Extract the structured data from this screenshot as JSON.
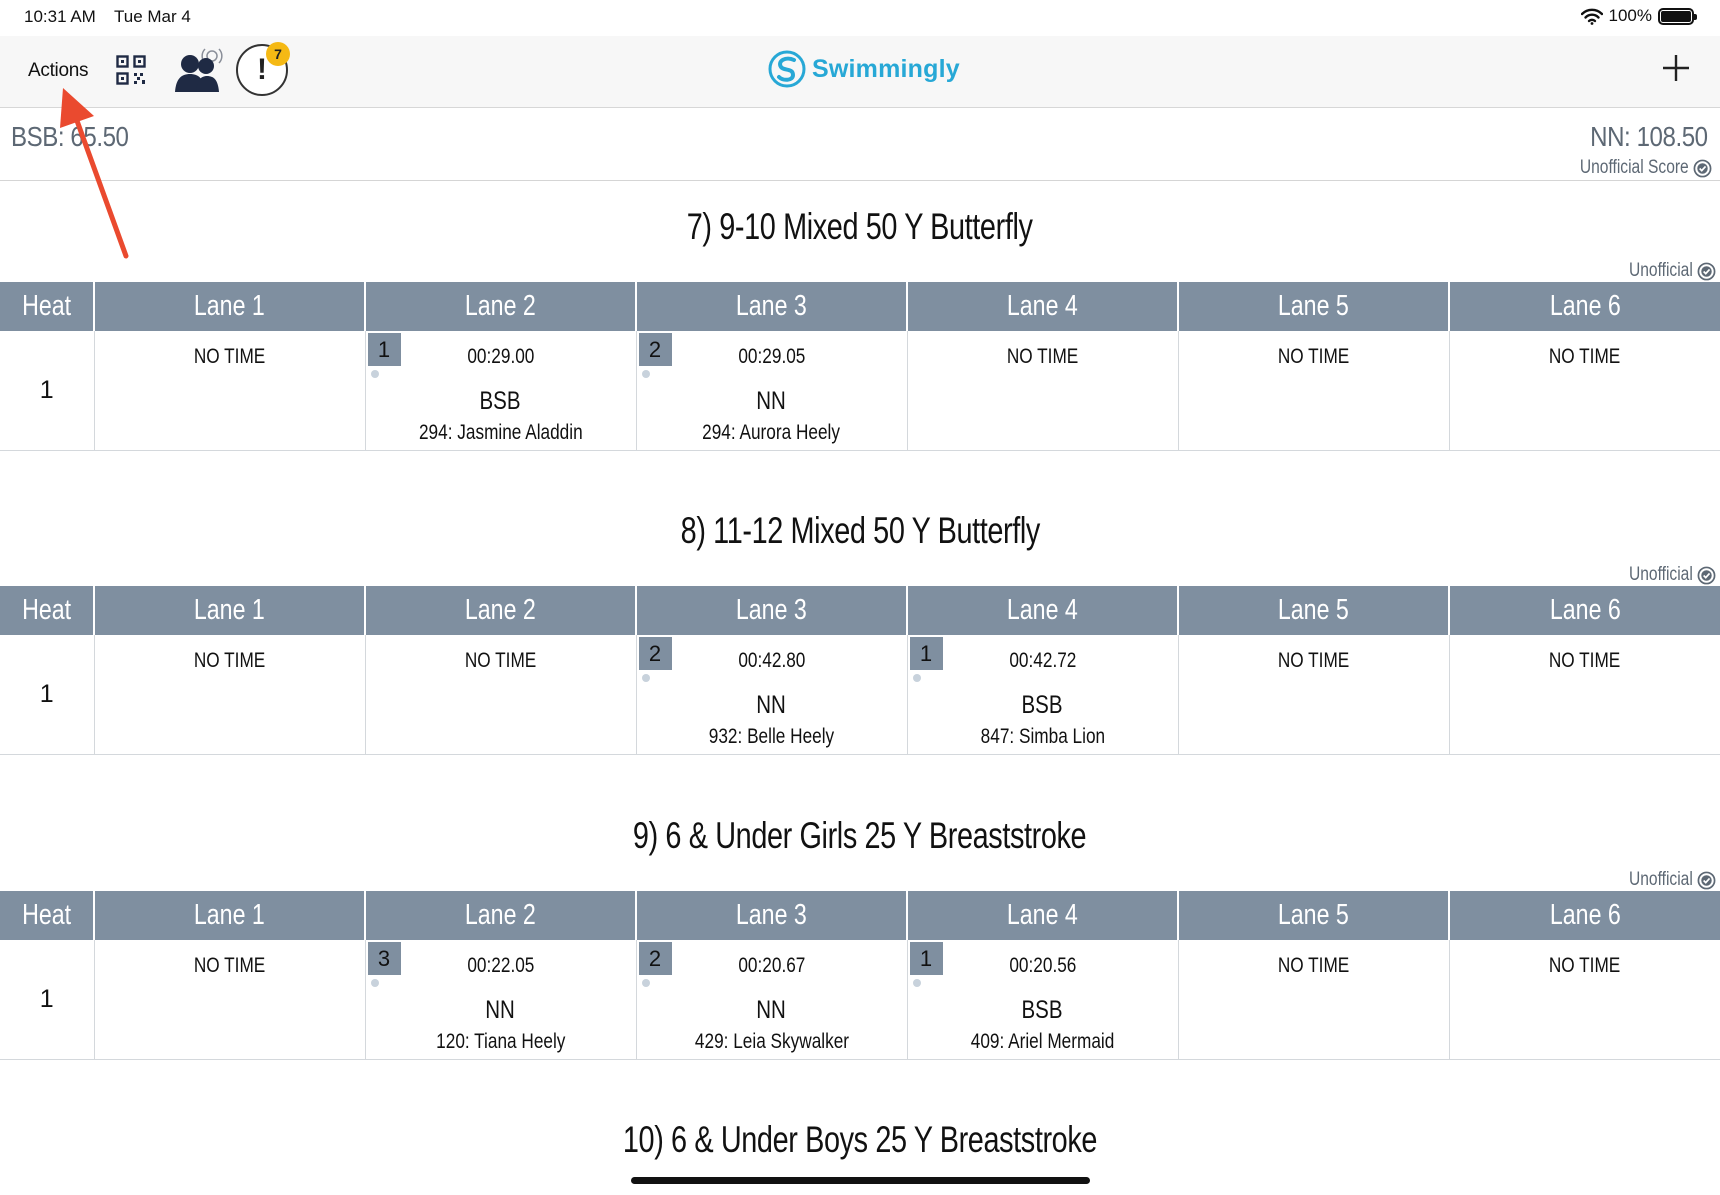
{
  "status_bar": {
    "time": "10:31 AM",
    "date": "Tue Mar 4",
    "battery": "100%"
  },
  "nav": {
    "actions_label": "Actions",
    "brand": "Swimmingly",
    "alert_count": "7",
    "alert_symbol": "!"
  },
  "icons": {
    "qr": "qr-code-icon",
    "people": "swimmers-broadcast-icon",
    "alert": "alert-icon",
    "add": "plus-icon",
    "wifi": "wifi-icon",
    "battery": "battery-icon",
    "check": "check-badge-icon"
  },
  "colors": {
    "header_bg": "#7f8fa0",
    "brand": "#27a8d6",
    "badge": "#f5b914",
    "arrow": "#ea4a2f"
  },
  "scores": {
    "left": "BSB: 65.50",
    "right": "NN: 108.50",
    "note": "Unofficial Score"
  },
  "unofficial_label": "Unofficial",
  "columns": [
    "Heat",
    "Lane 1",
    "Lane 2",
    "Lane 3",
    "Lane 4",
    "Lane 5",
    "Lane 6"
  ],
  "no_time": "NO TIME",
  "events": [
    {
      "title": "7) 9-10 Mixed 50 Y Butterfly",
      "heat": "1",
      "lanes": [
        {
          "no_time": true
        },
        {
          "place": "1",
          "time": "00:29.00",
          "team": "BSB",
          "swimmer": "294: Jasmine Aladdin"
        },
        {
          "place": "2",
          "time": "00:29.05",
          "team": "NN",
          "swimmer": "294: Aurora Heely"
        },
        {
          "no_time": true
        },
        {
          "no_time": true
        },
        {
          "no_time": true
        }
      ]
    },
    {
      "title": "8) 11-12 Mixed 50 Y Butterfly",
      "heat": "1",
      "lanes": [
        {
          "no_time": true
        },
        {
          "no_time": true
        },
        {
          "place": "2",
          "time": "00:42.80",
          "team": "NN",
          "swimmer": "932: Belle Heely"
        },
        {
          "place": "1",
          "time": "00:42.72",
          "team": "BSB",
          "swimmer": "847: Simba Lion"
        },
        {
          "no_time": true
        },
        {
          "no_time": true
        }
      ]
    },
    {
      "title": "9) 6 & Under Girls 25 Y Breaststroke",
      "heat": "1",
      "lanes": [
        {
          "no_time": true
        },
        {
          "place": "3",
          "time": "00:22.05",
          "team": "NN",
          "swimmer": "120: Tiana Heely"
        },
        {
          "place": "2",
          "time": "00:20.67",
          "team": "NN",
          "swimmer": "429: Leia Skywalker"
        },
        {
          "place": "1",
          "time": "00:20.56",
          "team": "BSB",
          "swimmer": "409: Ariel Mermaid"
        },
        {
          "no_time": true
        },
        {
          "no_time": true
        }
      ]
    }
  ],
  "next_event_title": "10) 6 & Under Boys 25 Y Breaststroke"
}
